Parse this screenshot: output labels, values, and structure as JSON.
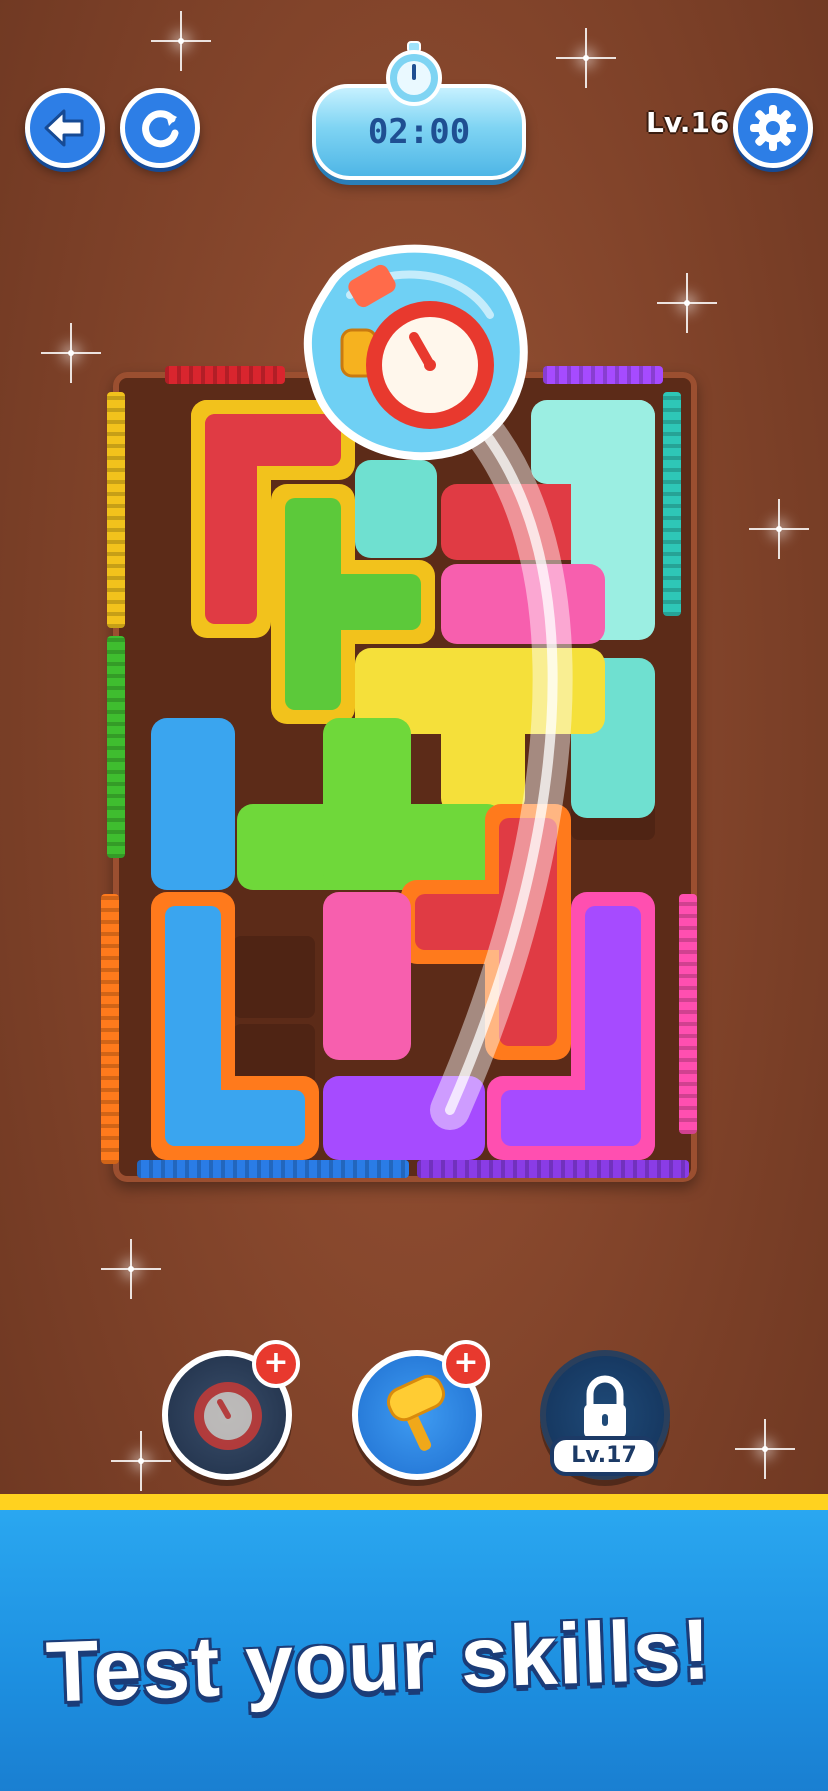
{
  "header": {
    "timer": "02:00",
    "level": "Lv.16",
    "back_icon": "back-arrow-icon",
    "restart_icon": "restart-icon",
    "settings_icon": "gear-icon"
  },
  "board": {
    "title": "",
    "gates": [
      {
        "side": "top",
        "color": "#d9252e"
      },
      {
        "side": "top",
        "color": "#a64bff"
      },
      {
        "side": "left",
        "color": "#f2c21c"
      },
      {
        "side": "left",
        "color": "#3fbd2f"
      },
      {
        "side": "left",
        "color": "#ff7a1c"
      },
      {
        "side": "right",
        "color": "#2ec7b7"
      },
      {
        "side": "right",
        "color": "#ff4fb0"
      },
      {
        "side": "bottom",
        "color": "#2a7ce6"
      },
      {
        "side": "bottom",
        "color": "#8a3ce6"
      }
    ]
  },
  "powerups": {
    "freeze": {
      "plus": "+",
      "icon": "stopwatch-icon"
    },
    "hammer": {
      "plus": "+",
      "icon": "hammer-icon"
    },
    "locked": {
      "label": "Lv.17",
      "icon": "lock-icon"
    }
  },
  "banner": {
    "text": "Test your skills!"
  },
  "colors": {
    "accent_blue": "#2d7ee6",
    "banner_yellow": "#ffd21f",
    "board_brown": "#5c2b18"
  }
}
